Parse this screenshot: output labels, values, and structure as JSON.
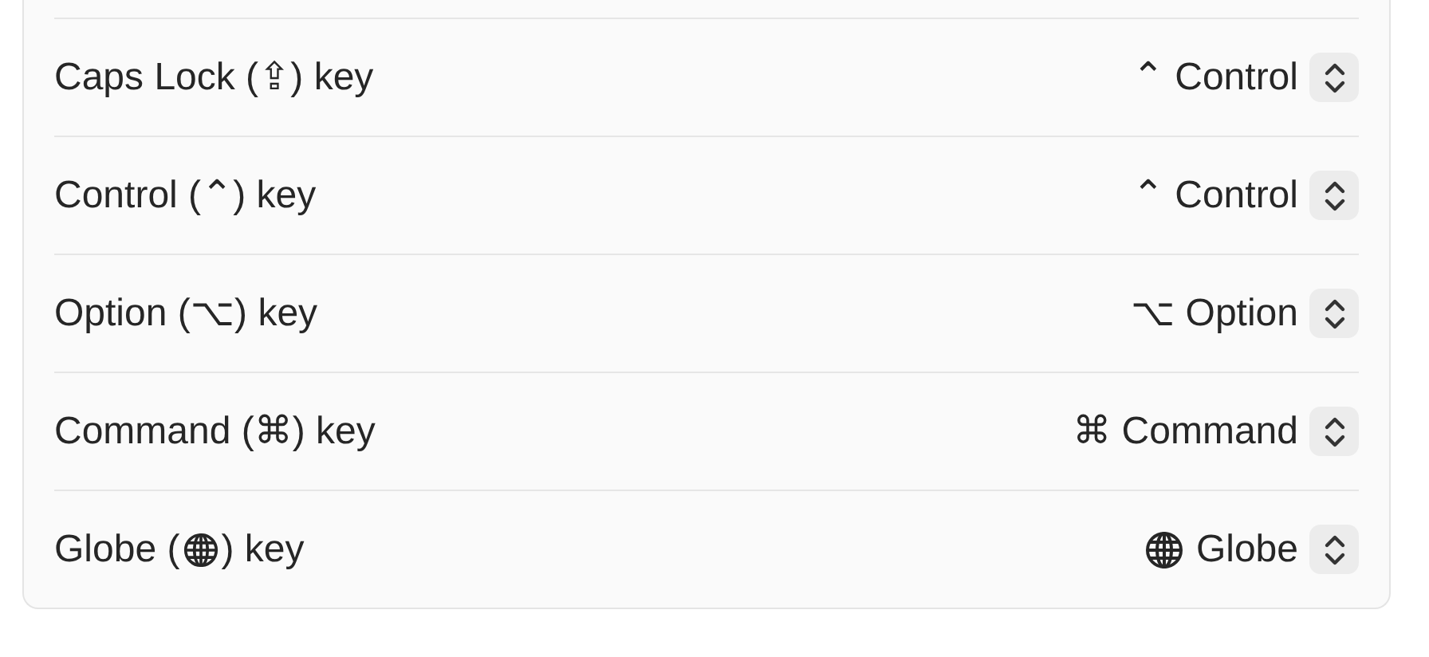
{
  "rows": [
    {
      "kind": "text",
      "label": "Caps Lock (⇪) key",
      "value": "⌃ Control"
    },
    {
      "kind": "text",
      "label": "Control (⌃) key",
      "value": "⌃ Control"
    },
    {
      "kind": "text",
      "label": "Option (⌥) key",
      "value": "⌥ Option"
    },
    {
      "kind": "text",
      "label": "Command (⌘) key",
      "value": "⌘ Command"
    },
    {
      "kind": "globe",
      "label_before": "Globe (",
      "label_after": ") key",
      "value": "Globe"
    }
  ]
}
